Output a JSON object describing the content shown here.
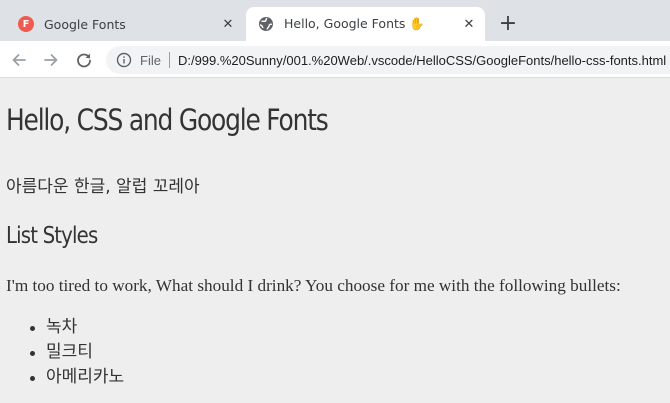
{
  "browser": {
    "tabs": [
      {
        "title": "Google Fonts",
        "favicon_letter": "F",
        "favicon_color": "#f15a4f",
        "active": false
      },
      {
        "title": "Hello, Google Fonts ✋",
        "favicon": "globe-icon",
        "active": true
      }
    ],
    "new_tab_label": "+",
    "close_glyph": "✕",
    "address": {
      "scheme_label": "File",
      "url": "D:/999.%20Sunny/001.%20Web/.vscode/HelloCSS/GoogleFonts/hello-css-fonts.html"
    },
    "colors": {
      "tabstrip": "#dee1e6",
      "toolbar": "#ffffff",
      "page_bg": "#eeeeee",
      "text": "#333333"
    }
  },
  "page": {
    "heading": "Hello, CSS and Google Fonts",
    "korean_text": "아름다운 한글, 알럽 꼬레아",
    "subheading": "List Styles",
    "paragraph": "I'm too tired to work, What should I drink? You choose for me with the following bullets:",
    "list_items": [
      "녹차",
      "밀크티",
      "아메리카노"
    ]
  }
}
